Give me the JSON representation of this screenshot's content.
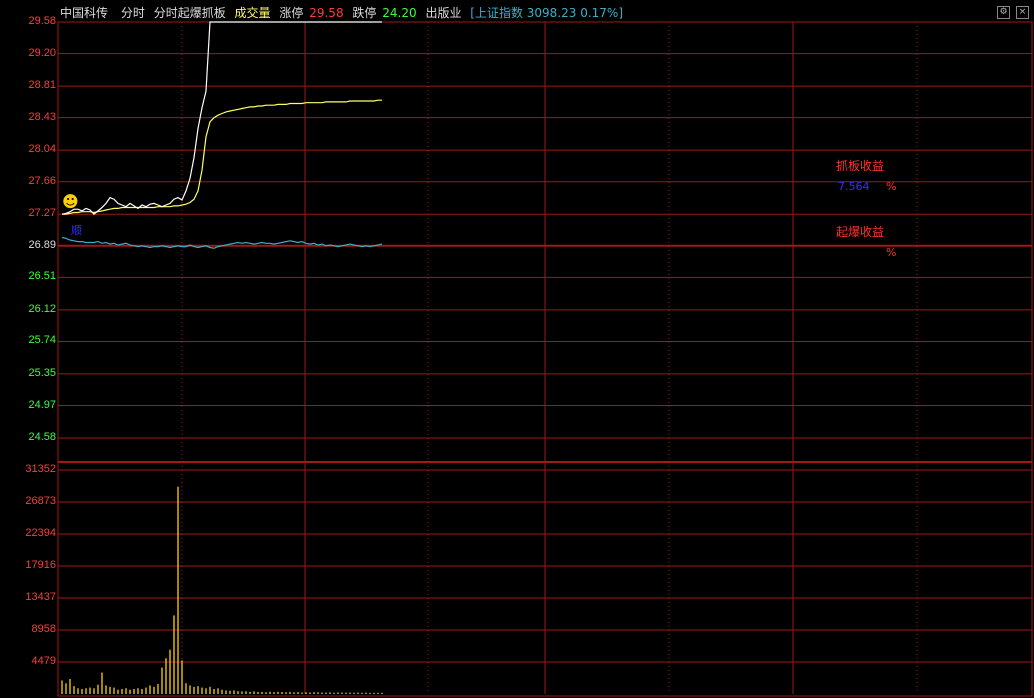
{
  "header": {
    "stock_name": "中国科传",
    "mode": "分时",
    "indicator": "分时起爆抓板",
    "volume_label": "成交量",
    "limit_up_label": "涨停",
    "limit_up_value": "29.58",
    "limit_down_label": "跌停",
    "limit_down_value": "24.20",
    "sector": "出版业",
    "index_text": "[上证指数 3098.23 0.17%]"
  },
  "controls": {
    "settings_glyph": "⚙",
    "close_glyph": "×"
  },
  "annotations": {
    "grab_board_label": "抓板收益",
    "grab_board_value": "7.564",
    "grab_board_pct": "%",
    "breakout_label": "起爆收益",
    "breakout_value": "",
    "breakout_pct": "%",
    "marker_text": "顺",
    "smiley": "☻"
  },
  "colors": {
    "bg": "#000000",
    "grid": "#a01818",
    "axis_red": "#ff3c3c",
    "axis_green": "#3cff3c",
    "price_line": "#ffffff",
    "avg_line": "#ffff66",
    "indicator_line": "#3ab0c8",
    "volume_bar": "#ffd000",
    "annotation_red": "#ff3030",
    "annotation_blue": "#3030ff"
  },
  "chart_data": {
    "type": "line",
    "price_axis": {
      "ticks": [
        "29.58",
        "29.20",
        "28.81",
        "28.43",
        "28.04",
        "27.66",
        "27.27",
        "26.89",
        "26.51",
        "26.12",
        "25.74",
        "25.35",
        "24.97",
        "24.58"
      ],
      "ylim": [
        24.58,
        29.58
      ],
      "prev_close": 26.89
    },
    "volume_axis": {
      "ticks": [
        "31352",
        "26873",
        "22394",
        "17916",
        "13437",
        "8958",
        "4479"
      ],
      "ylim": [
        0,
        31352
      ]
    },
    "series": [
      {
        "key": "price",
        "values": [
          27.27,
          27.28,
          27.3,
          27.33,
          27.33,
          27.31,
          27.34,
          27.32,
          27.27,
          27.31,
          27.35,
          27.4,
          27.47,
          27.45,
          27.4,
          27.38,
          27.36,
          27.4,
          27.37,
          27.34,
          27.38,
          27.36,
          27.39,
          27.4,
          27.38,
          27.36,
          27.38,
          27.4,
          27.45,
          27.47,
          27.44,
          27.55,
          27.7,
          27.95,
          28.3,
          28.55,
          28.75,
          29.58,
          29.58,
          29.58,
          29.58,
          29.58,
          29.58,
          29.58,
          29.58,
          29.58,
          29.58,
          29.58,
          29.58,
          29.58,
          29.58,
          29.58,
          29.58,
          29.58,
          29.58,
          29.58,
          29.58,
          29.58,
          29.58,
          29.58,
          29.58,
          29.58,
          29.58,
          29.58,
          29.58,
          29.58,
          29.58,
          29.58,
          29.58,
          29.58,
          29.58,
          29.58,
          29.58,
          29.58,
          29.58,
          29.58,
          29.58,
          29.58,
          29.58,
          29.58,
          29.58
        ]
      },
      {
        "key": "average",
        "values": [
          27.27,
          27.27,
          27.28,
          27.29,
          27.29,
          27.3,
          27.3,
          27.3,
          27.29,
          27.3,
          27.31,
          27.32,
          27.33,
          27.34,
          27.34,
          27.35,
          27.35,
          27.35,
          27.35,
          27.35,
          27.35,
          27.35,
          27.35,
          27.35,
          27.36,
          27.36,
          27.36,
          27.36,
          27.37,
          27.37,
          27.38,
          27.39,
          27.41,
          27.45,
          27.55,
          27.8,
          28.2,
          28.38,
          28.43,
          28.46,
          28.48,
          28.5,
          28.51,
          28.52,
          28.53,
          28.54,
          28.55,
          28.56,
          28.56,
          28.57,
          28.57,
          28.58,
          28.58,
          28.58,
          28.59,
          28.59,
          28.59,
          28.6,
          28.6,
          28.6,
          28.6,
          28.61,
          28.61,
          28.61,
          28.61,
          28.61,
          28.62,
          28.62,
          28.62,
          28.62,
          28.62,
          28.62,
          28.63,
          28.63,
          28.63,
          28.63,
          28.63,
          28.63,
          28.63,
          28.64,
          28.64
        ]
      },
      {
        "key": "indicator",
        "values": [
          26.99,
          26.98,
          26.96,
          26.95,
          26.94,
          26.94,
          26.93,
          26.93,
          26.93,
          26.94,
          26.92,
          26.93,
          26.91,
          26.92,
          26.9,
          26.91,
          26.92,
          26.9,
          26.89,
          26.88,
          26.89,
          26.88,
          26.87,
          26.88,
          26.88,
          26.89,
          26.88,
          26.87,
          26.88,
          26.89,
          26.88,
          26.88,
          26.9,
          26.88,
          26.87,
          26.88,
          26.89,
          26.87,
          26.86,
          26.88,
          26.89,
          26.9,
          26.91,
          26.92,
          26.93,
          26.92,
          26.93,
          26.92,
          26.91,
          26.92,
          26.93,
          26.92,
          26.92,
          26.91,
          26.92,
          26.93,
          26.94,
          26.95,
          26.94,
          26.93,
          26.94,
          26.92,
          26.91,
          26.92,
          26.9,
          26.91,
          26.89,
          26.9,
          26.89,
          26.88,
          26.89,
          26.9,
          26.91,
          26.9,
          26.89,
          26.88,
          26.89,
          26.88,
          26.89,
          26.9,
          26.91
        ]
      },
      {
        "key": "volume",
        "values": [
          1900,
          1500,
          2100,
          1100,
          800,
          700,
          800,
          900,
          800,
          1300,
          3000,
          1200,
          1000,
          900,
          600,
          700,
          800,
          600,
          700,
          800,
          700,
          900,
          1200,
          1000,
          1400,
          3700,
          5000,
          6200,
          11000,
          29000,
          4700,
          1500,
          1200,
          1000,
          1100,
          900,
          800,
          1000,
          700,
          800,
          600,
          500,
          450,
          500,
          400,
          350,
          380,
          300,
          360,
          280,
          300,
          250,
          320,
          260,
          300,
          280,
          250,
          300,
          230,
          260,
          200,
          240,
          220,
          260,
          230,
          210,
          200,
          230,
          180,
          220,
          200,
          190,
          210,
          180,
          200,
          170,
          190,
          160,
          180,
          170,
          160
        ]
      }
    ],
    "grid": true
  }
}
